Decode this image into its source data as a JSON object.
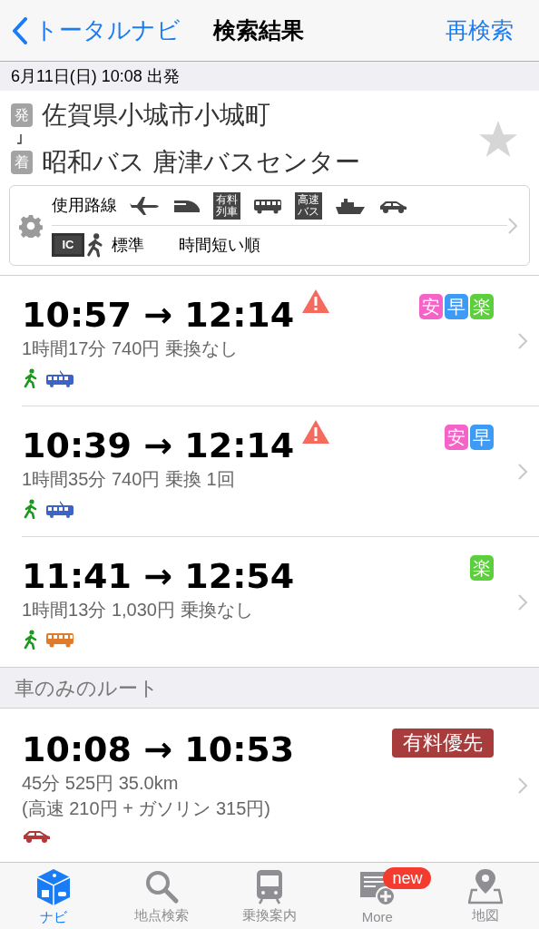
{
  "nav": {
    "back": "トータルナビ",
    "title": "検索結果",
    "action": "再検索"
  },
  "date_bar": "6月11日(日) 10:08 出発",
  "trip": {
    "from_mark": "発",
    "from": "佐賀県小城市小城町",
    "to_mark": "着",
    "to": "昭和バス 唐津バスセンター",
    "favorite": false
  },
  "options": {
    "label": "使用路線",
    "modes": [
      {
        "kind": "plane"
      },
      {
        "kind": "shinkansen"
      },
      {
        "kind": "badge",
        "lines": [
          "有料",
          "列車"
        ]
      },
      {
        "kind": "bus"
      },
      {
        "kind": "badge",
        "lines": [
          "高速",
          "バス"
        ]
      },
      {
        "kind": "ship"
      },
      {
        "kind": "car"
      }
    ],
    "ic": "IC",
    "walk_speed": "標準",
    "sort": "時間短い順"
  },
  "routes": [
    {
      "time": "10:57 → 12:14",
      "warning": true,
      "tags": [
        {
          "text": "安",
          "color": "#f562c8"
        },
        {
          "text": "早",
          "color": "#3d9bf5"
        },
        {
          "text": "楽",
          "color": "#5ccf3c"
        }
      ],
      "details": [
        "1時間17分 740円 乗換なし"
      ],
      "modes": [
        {
          "kind": "walk"
        },
        {
          "kind": "tram"
        }
      ]
    },
    {
      "time": "10:39 → 12:14",
      "warning": true,
      "tags": [
        {
          "text": "安",
          "color": "#f562c8"
        },
        {
          "text": "早",
          "color": "#3d9bf5"
        }
      ],
      "details": [
        "1時間35分 740円 乗換 1回"
      ],
      "modes": [
        {
          "kind": "walk"
        },
        {
          "kind": "tram"
        }
      ]
    },
    {
      "time": "11:41 → 12:54",
      "warning": false,
      "tags": [
        {
          "text": "楽",
          "color": "#5ccf3c"
        }
      ],
      "details": [
        "1時間13分 1,030円 乗換なし"
      ],
      "modes": [
        {
          "kind": "walk"
        },
        {
          "kind": "bus"
        }
      ]
    }
  ],
  "car_section": {
    "header": "車のみのルート",
    "route": {
      "time": "10:08 → 10:53",
      "tags": [
        {
          "text": "有料優先",
          "color": "#a83c3c"
        }
      ],
      "details": [
        "45分 525円 35.0km",
        "(高速 210円 + ガソリン 315円)"
      ],
      "modes": [
        {
          "kind": "car"
        }
      ]
    }
  },
  "tab_bar": [
    {
      "label": "ナビ",
      "kind": "navi",
      "selected": true
    },
    {
      "label": "地点検索",
      "kind": "search",
      "selected": false
    },
    {
      "label": "乗換案内",
      "kind": "train",
      "selected": false
    },
    {
      "label": "More",
      "kind": "more",
      "selected": false,
      "badge": "new"
    },
    {
      "label": "地図",
      "kind": "map",
      "selected": false
    }
  ]
}
